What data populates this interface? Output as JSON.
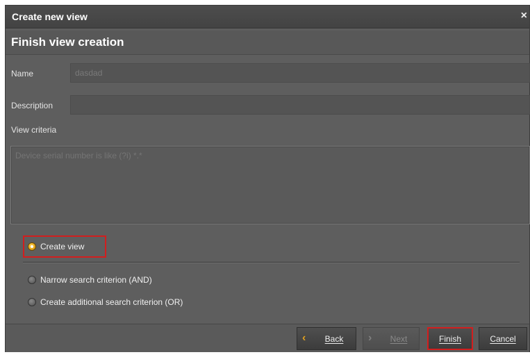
{
  "dialog": {
    "title": "Create new view",
    "close_glyph": "×",
    "heading": "Finish view creation"
  },
  "form": {
    "name_label": "Name",
    "name_value": "dasdad",
    "description_label": "Description",
    "description_value": "",
    "criteria_label": "View criteria",
    "criteria_text": "Device serial number is like (?i) *.*"
  },
  "options": {
    "create_view": "Create view",
    "narrow": "Narrow search criterion (AND)",
    "additional": "Create additional search criterion (OR)",
    "selected": "create_view"
  },
  "buttons": {
    "back": "Back",
    "next": "Next",
    "finish": "Finish",
    "cancel": "Cancel"
  },
  "colors": {
    "highlight": "#d21e1e",
    "accent": "#e0a020",
    "background": "#5e5e5e"
  },
  "icons": {
    "close": "close-icon",
    "back": "chevron-left-icon",
    "next": "chevron-right-icon"
  }
}
